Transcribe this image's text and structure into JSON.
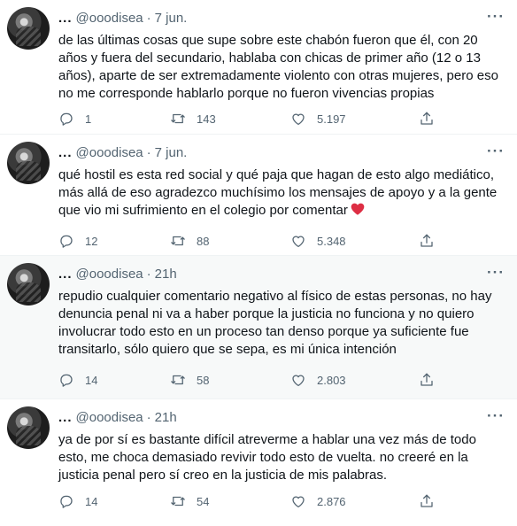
{
  "tweets": [
    {
      "handle": "@ooodisea",
      "time": "7 jun.",
      "ellipsis": "...",
      "text": "de las últimas cosas que supe sobre este chabón fueron que él, con 20 años y fuera del secundario, hablaba con chicas de primer año (12 o 13 años), aparte de ser extremadamente violento con otras mujeres, pero eso no me corresponde hablarlo porque no fueron vivencias propias",
      "replies": "1",
      "retweets": "143",
      "likes": "5.197"
    },
    {
      "handle": "@ooodisea",
      "time": "7 jun.",
      "ellipsis": "...",
      "text": "qué hostil es esta red social y qué paja que hagan de esto algo mediático, más allá de eso agradezco muchísimo los mensajes de apoyo y a la gente que vio mi sufrimiento en el colegio por comentar",
      "emoji": "red-heart",
      "replies": "12",
      "retweets": "88",
      "likes": "5.348"
    },
    {
      "handle": "@ooodisea",
      "time": "21h",
      "ellipsis": "...",
      "text": "repudio cualquier comentario negativo al físico de estas personas, no hay denuncia penal ni va a haber porque la justicia no funciona y no quiero involucrar todo esto en un proceso tan denso porque ya suficiente fue transitarlo, sólo quiero que se sepa, es mi única intención",
      "replies": "14",
      "retweets": "58",
      "likes": "2.803"
    },
    {
      "handle": "@ooodisea",
      "time": "21h",
      "ellipsis": "...",
      "text": "ya de por sí es bastante difícil atreverme a hablar una vez más de todo esto, me choca demasiado revivir todo esto de vuelta. no creeré en la justicia penal pero sí creo en la justicia de mis palabras.",
      "replies": "14",
      "retweets": "54",
      "likes": "2.876"
    }
  ],
  "time_separator": "·",
  "more_label": "···",
  "colors": {
    "text": "#0f1419",
    "muted": "#536471",
    "heart": "#e0245e",
    "divider": "#eff3f4",
    "shaded": "#f7f9f9"
  }
}
